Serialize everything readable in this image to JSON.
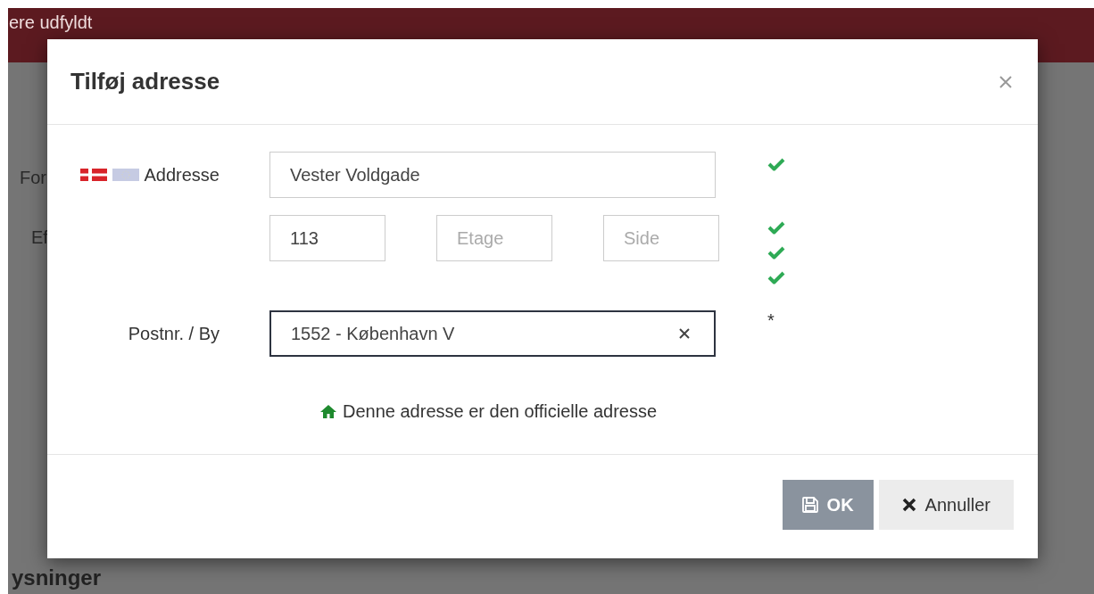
{
  "background": {
    "banner_text": "ere udfyldt",
    "labels": [
      "For",
      "Ef"
    ],
    "section_heading": "ysninger"
  },
  "dialog": {
    "title": "Tilføj adresse",
    "street": {
      "label": "Addresse",
      "value": "Vester Voldgade",
      "valid": true
    },
    "details": [
      {
        "value": "113",
        "valid": true
      },
      {
        "placeholder": "Etage",
        "valid": true
      },
      {
        "placeholder": "Side",
        "valid": true
      }
    ],
    "postal": {
      "label": "Postnr. / By",
      "value": "1552 - København V",
      "focused": true,
      "marker": "*"
    },
    "note": "Denne adresse er den officielle adresse",
    "buttons": [
      {
        "label": "OK",
        "kind": "primary"
      },
      {
        "label": "Annuller",
        "kind": "secondary"
      }
    ]
  }
}
